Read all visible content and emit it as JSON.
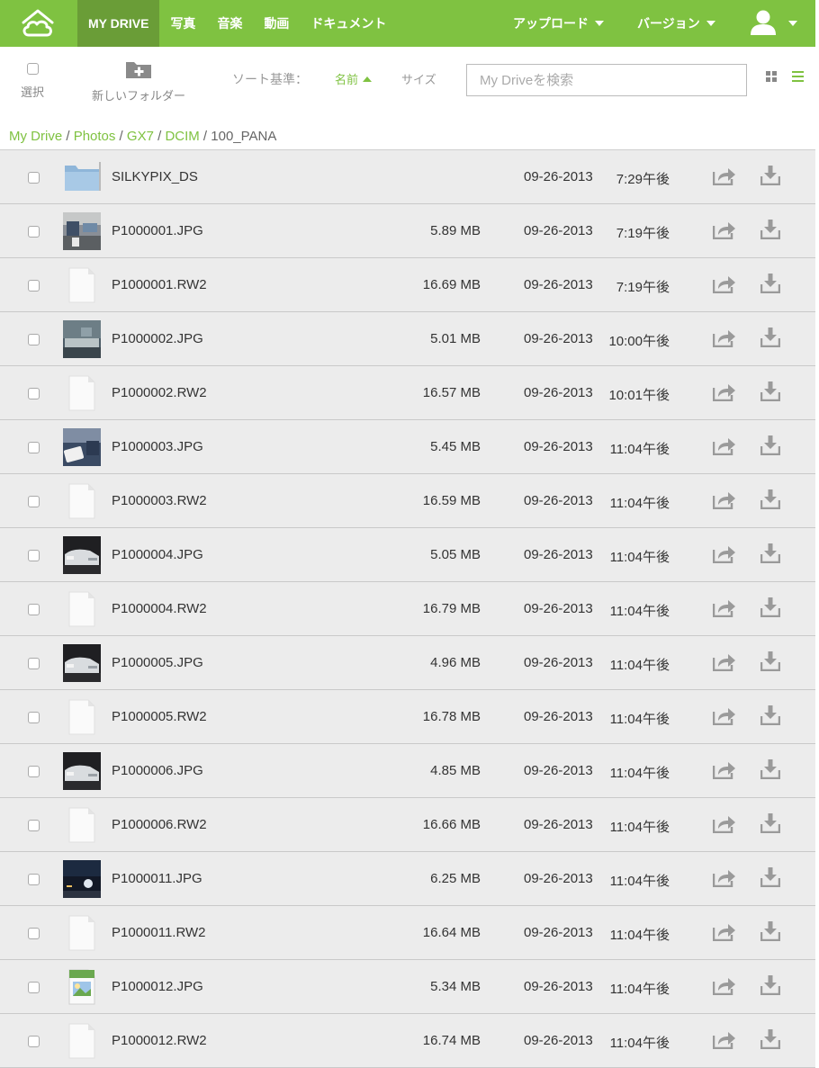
{
  "topnav": {
    "items": [
      {
        "label": "MY DRIVE",
        "active": true
      },
      {
        "label": "写真",
        "active": false
      },
      {
        "label": "音楽",
        "active": false
      },
      {
        "label": "動画",
        "active": false
      },
      {
        "label": "ドキュメント",
        "active": false
      }
    ],
    "upload_label": "アップロード",
    "version_label": "バージョン"
  },
  "toolbar": {
    "select_label": "選択",
    "new_folder_label": "新しいフォルダー",
    "sort_label": "ソート基準：",
    "sort_name_label": "名前",
    "sort_size_label": "サイズ",
    "search_placeholder": "My Driveを検索"
  },
  "breadcrumb": [
    "My Drive",
    "Photos",
    "GX7",
    "DCIM",
    "100_PANA"
  ],
  "files": [
    {
      "name": "SILKYPIX_DS",
      "size": "",
      "date": "09-26-2013",
      "time": "7:29午後",
      "thumb": "folder"
    },
    {
      "name": "P1000001.JPG",
      "size": "5.89 MB",
      "date": "09-26-2013",
      "time": "7:19午後",
      "thumb": "photo-room"
    },
    {
      "name": "P1000001.RW2",
      "size": "16.69 MB",
      "date": "09-26-2013",
      "time": "7:19午後",
      "thumb": "file"
    },
    {
      "name": "P1000002.JPG",
      "size": "5.01 MB",
      "date": "09-26-2013",
      "time": "10:00午後",
      "thumb": "photo-desk"
    },
    {
      "name": "P1000002.RW2",
      "size": "16.57 MB",
      "date": "09-26-2013",
      "time": "10:01午後",
      "thumb": "file"
    },
    {
      "name": "P1000003.JPG",
      "size": "5.45 MB",
      "date": "09-26-2013",
      "time": "11:04午後",
      "thumb": "photo-phone"
    },
    {
      "name": "P1000003.RW2",
      "size": "16.59 MB",
      "date": "09-26-2013",
      "time": "11:04午後",
      "thumb": "file"
    },
    {
      "name": "P1000004.JPG",
      "size": "5.05 MB",
      "date": "09-26-2013",
      "time": "11:04午後",
      "thumb": "photo-car"
    },
    {
      "name": "P1000004.RW2",
      "size": "16.79 MB",
      "date": "09-26-2013",
      "time": "11:04午後",
      "thumb": "file"
    },
    {
      "name": "P1000005.JPG",
      "size": "4.96 MB",
      "date": "09-26-2013",
      "time": "11:04午後",
      "thumb": "photo-car"
    },
    {
      "name": "P1000005.RW2",
      "size": "16.78 MB",
      "date": "09-26-2013",
      "time": "11:04午後",
      "thumb": "file"
    },
    {
      "name": "P1000006.JPG",
      "size": "4.85 MB",
      "date": "09-26-2013",
      "time": "11:04午後",
      "thumb": "photo-car"
    },
    {
      "name": "P1000006.RW2",
      "size": "16.66 MB",
      "date": "09-26-2013",
      "time": "11:04午後",
      "thumb": "file"
    },
    {
      "name": "P1000011.JPG",
      "size": "6.25 MB",
      "date": "09-26-2013",
      "time": "11:04午後",
      "thumb": "photo-night"
    },
    {
      "name": "P1000011.RW2",
      "size": "16.64 MB",
      "date": "09-26-2013",
      "time": "11:04午後",
      "thumb": "file"
    },
    {
      "name": "P1000012.JPG",
      "size": "5.34 MB",
      "date": "09-26-2013",
      "time": "11:04午後",
      "thumb": "image-file"
    },
    {
      "name": "P1000012.RW2",
      "size": "16.74 MB",
      "date": "09-26-2013",
      "time": "11:04午後",
      "thumb": "file"
    }
  ],
  "colors": {
    "accent": "#7fc241",
    "accent_dark": "#6a9d37",
    "row_bg": "#ececec"
  }
}
